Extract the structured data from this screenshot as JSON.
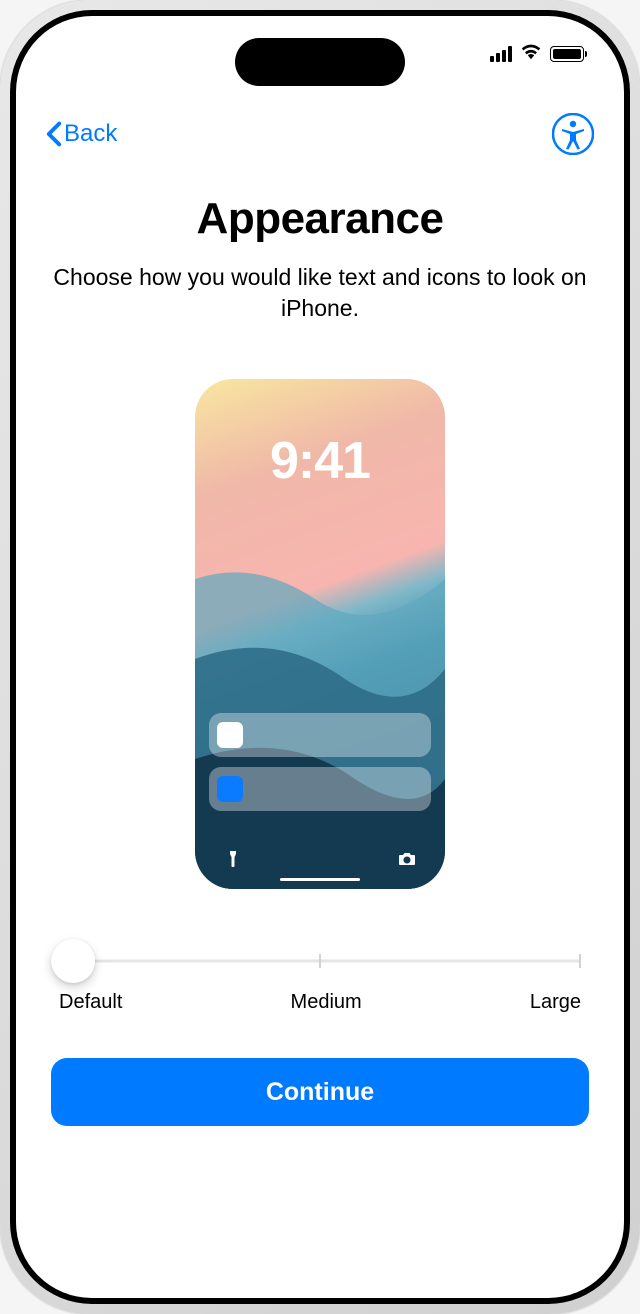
{
  "nav": {
    "back_label": "Back"
  },
  "header": {
    "title": "Appearance",
    "subtitle": "Choose how you would like text and icons to look on iPhone."
  },
  "preview": {
    "time": "9:41"
  },
  "slider": {
    "labels": {
      "default": "Default",
      "medium": "Medium",
      "large": "Large"
    },
    "selected": "Default"
  },
  "actions": {
    "continue_label": "Continue"
  },
  "colors": {
    "accent": "#007AFF"
  }
}
